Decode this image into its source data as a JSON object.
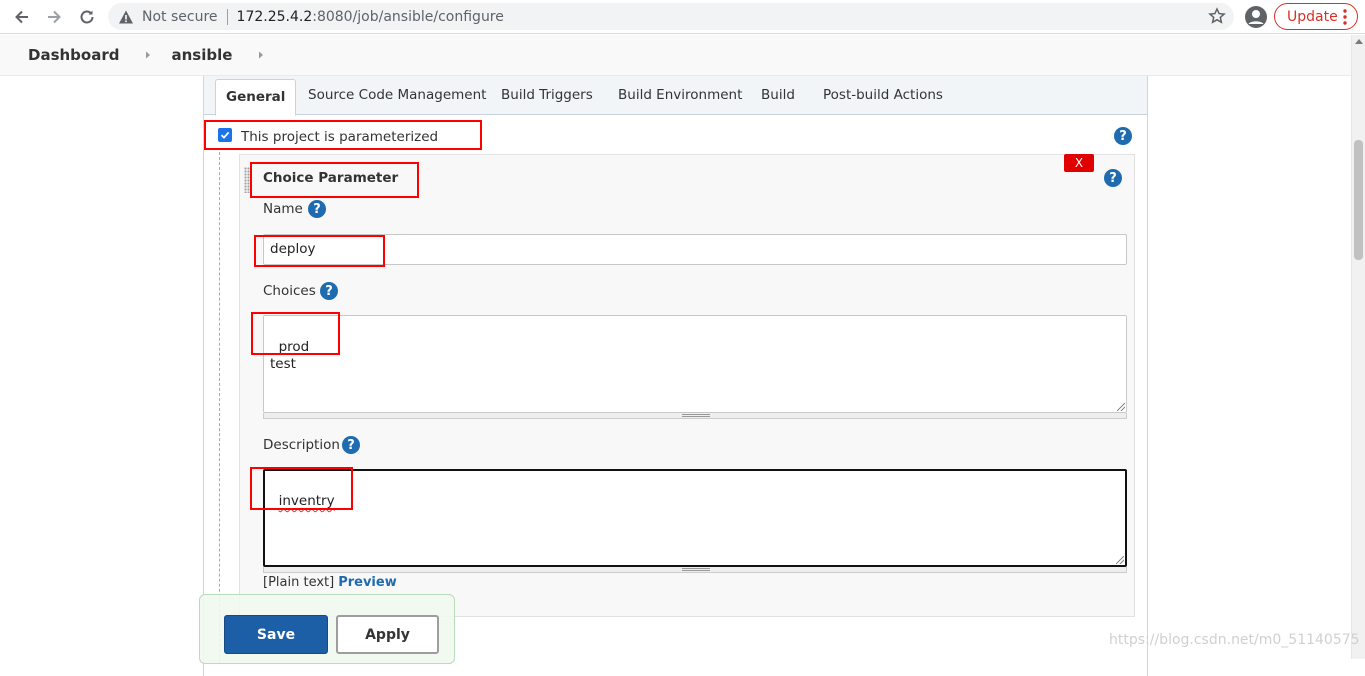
{
  "browser": {
    "security_label": "Not secure",
    "url_host": "172.25.4.2",
    "url_path": ":8080/job/ansible/configure",
    "update_label": "Update"
  },
  "breadcrumb": {
    "items": [
      "Dashboard",
      "ansible"
    ]
  },
  "tabs": [
    {
      "label": "General",
      "active": true
    },
    {
      "label": "Source Code Management",
      "active": false
    },
    {
      "label": "Build Triggers",
      "active": false
    },
    {
      "label": "Build Environment",
      "active": false
    },
    {
      "label": "Build",
      "active": false
    },
    {
      "label": "Post-build Actions",
      "active": false
    }
  ],
  "general": {
    "parameterized_label": "This project is parameterized",
    "parameterized_checked": true
  },
  "parameter": {
    "title": "Choice Parameter",
    "delete_label": "X",
    "name_label": "Name",
    "name_value": "deploy",
    "choices_label": "Choices",
    "choices_value": "prod\ntest",
    "description_label": "Description",
    "description_value": "inventry",
    "format_label": "[Plain text]",
    "preview_label": "Preview"
  },
  "help_glyph": "?",
  "actions": {
    "save_label": "Save",
    "apply_label": "Apply"
  },
  "watermark": "https://blog.csdn.net/m0_51140575",
  "colors": {
    "primary_button": "#1c5fa7",
    "help_icon": "#1e6bb0",
    "delete_button": "#e00000",
    "annotation": "#ff0000"
  }
}
